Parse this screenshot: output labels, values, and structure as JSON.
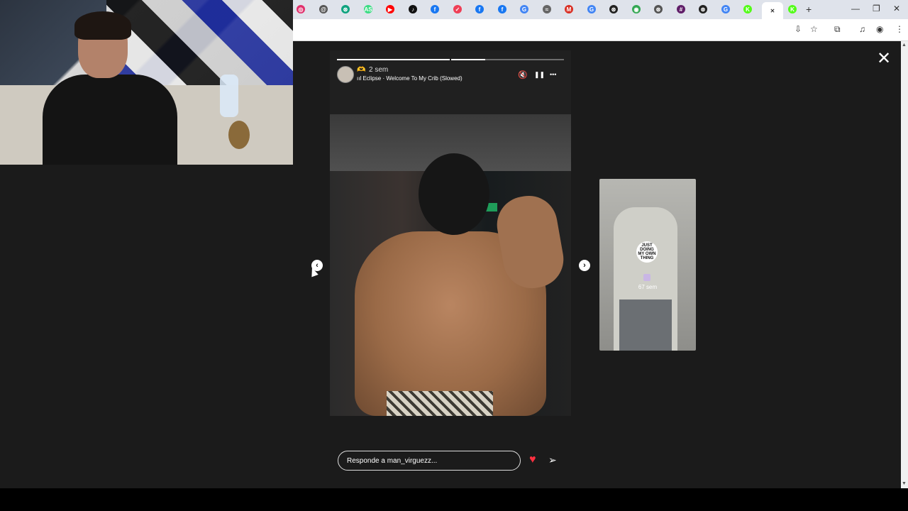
{
  "tabs": [
    {
      "icon": "instagram-icon",
      "glyph": "◎",
      "color": "#e1306c"
    },
    {
      "icon": "threads-icon",
      "glyph": "@",
      "color": "#555"
    },
    {
      "icon": "chatgpt-icon",
      "glyph": "⊛",
      "color": "#10a37f"
    },
    {
      "icon": "app-icon",
      "glyph": "AS",
      "color": "#3ddc84"
    },
    {
      "icon": "youtube-icon",
      "glyph": "▶",
      "color": "#ff0000"
    },
    {
      "icon": "tiktok-icon",
      "glyph": "♪",
      "color": "#111"
    },
    {
      "icon": "facebook-icon",
      "glyph": "f",
      "color": "#1877f2"
    },
    {
      "icon": "pocket-icon",
      "glyph": "✓",
      "color": "#ef3f56"
    },
    {
      "icon": "facebook-icon",
      "glyph": "f",
      "color": "#1877f2"
    },
    {
      "icon": "facebook-icon",
      "glyph": "f",
      "color": "#1877f2"
    },
    {
      "icon": "google-icon",
      "glyph": "G",
      "color": "#4285f4"
    },
    {
      "icon": "site-icon",
      "glyph": "≈",
      "color": "#666"
    },
    {
      "icon": "gmail-icon",
      "glyph": "M",
      "color": "#d93025"
    },
    {
      "icon": "google-icon",
      "glyph": "G",
      "color": "#4285f4"
    },
    {
      "icon": "chatgpt-icon",
      "glyph": "⊛",
      "color": "#222"
    },
    {
      "icon": "maps-icon",
      "glyph": "◉",
      "color": "#34a853"
    },
    {
      "icon": "chatgpt-icon",
      "glyph": "⊛",
      "color": "#555"
    },
    {
      "icon": "slack-icon",
      "glyph": "#",
      "color": "#611f69"
    },
    {
      "icon": "chatgpt-icon",
      "glyph": "⊛",
      "color": "#222"
    },
    {
      "icon": "google-icon",
      "glyph": "G",
      "color": "#4285f4"
    },
    {
      "icon": "kick-icon",
      "glyph": "K",
      "color": "#53fc18"
    },
    {
      "icon": "close-icon",
      "glyph": "✕",
      "color": "#333"
    },
    {
      "icon": "kick-icon",
      "glyph": "K",
      "color": "#53fc18"
    }
  ],
  "story": {
    "time_ago": "2 sem",
    "emoji": "🫶",
    "song": "ııl Eclipse · Welcome To My Crib (Slowed)",
    "mute_glyph": "🔇",
    "pause_glyph": "❚❚",
    "more_glyph": "•••",
    "progress": [
      1.0,
      0.3
    ],
    "progress_color": "#ffffff"
  },
  "next_preview": {
    "time_ago": "67 sem",
    "avatar_text": "JUST DOING MY OWN THING"
  },
  "reply": {
    "placeholder": "Responde a man_virguezz..."
  },
  "icons": {
    "close": "✕",
    "prev": "‹",
    "next": "›",
    "heart": "♥",
    "send": "➢"
  },
  "colors": {
    "page_bg": "#1b1b1b",
    "like": "#ff3040"
  }
}
